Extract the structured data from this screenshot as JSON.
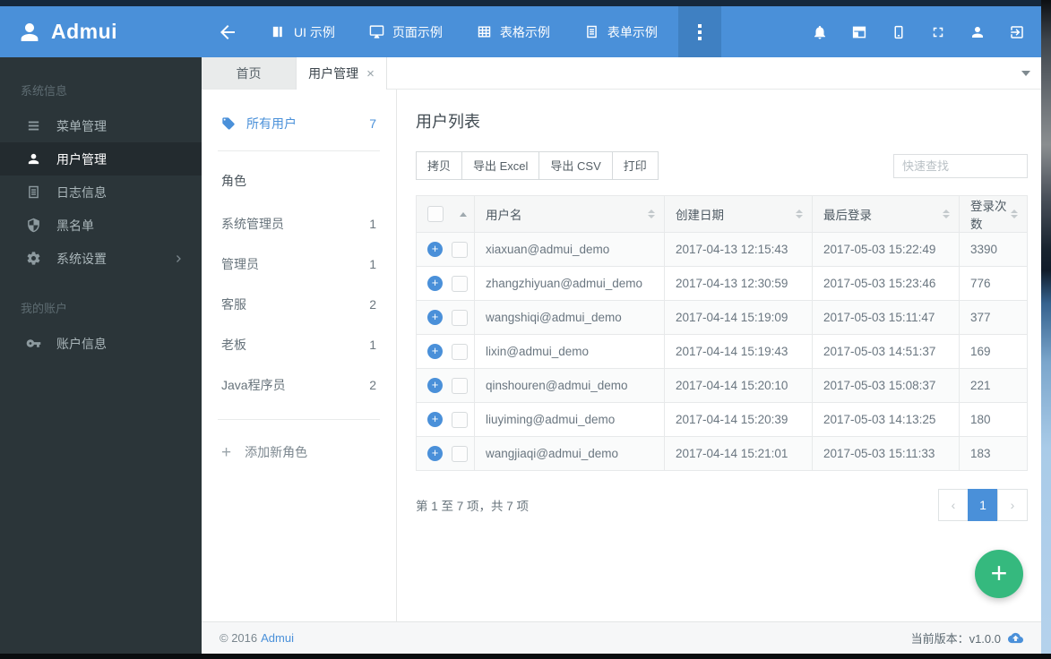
{
  "navbar": {
    "brand": "Admui",
    "items": [
      {
        "label": "UI 示例"
      },
      {
        "label": "页面示例"
      },
      {
        "label": "表格示例"
      },
      {
        "label": "表单示例"
      }
    ]
  },
  "sidebar": {
    "sections": [
      {
        "label": "系统信息",
        "items": [
          {
            "label": "菜单管理"
          },
          {
            "label": "用户管理"
          },
          {
            "label": "日志信息"
          },
          {
            "label": "黑名单"
          },
          {
            "label": "系统设置"
          }
        ]
      },
      {
        "label": "我的账户",
        "items": [
          {
            "label": "账户信息"
          }
        ]
      }
    ]
  },
  "tabs": [
    {
      "label": "首页"
    },
    {
      "label": "用户管理"
    }
  ],
  "user_panel": {
    "all_users_label": "所有用户",
    "all_users_count": "7",
    "roles_label": "角色",
    "roles": [
      {
        "name": "系统管理员",
        "count": "1"
      },
      {
        "name": "管理员",
        "count": "1"
      },
      {
        "name": "客服",
        "count": "2"
      },
      {
        "name": "老板",
        "count": "1"
      },
      {
        "name": "Java程序员",
        "count": "2"
      }
    ],
    "add_role_label": "添加新角色"
  },
  "main": {
    "title": "用户列表",
    "toolbar": {
      "copy": "拷贝",
      "export_excel": "导出 Excel",
      "export_csv": "导出 CSV",
      "print": "打印",
      "search_placeholder": "快速查找"
    },
    "table": {
      "columns": [
        "用户名",
        "创建日期",
        "最后登录",
        "登录次数"
      ],
      "rows": [
        {
          "username": "xiaxuan@admui_demo",
          "created": "2017-04-13 12:15:43",
          "last_login": "2017-05-03 15:22:49",
          "logins": "3390"
        },
        {
          "username": "zhangzhiyuan@admui_demo",
          "created": "2017-04-13 12:30:59",
          "last_login": "2017-05-03 15:23:46",
          "logins": "776"
        },
        {
          "username": "wangshiqi@admui_demo",
          "created": "2017-04-14 15:19:09",
          "last_login": "2017-05-03 15:11:47",
          "logins": "377"
        },
        {
          "username": "lixin@admui_demo",
          "created": "2017-04-14 15:19:43",
          "last_login": "2017-05-03 14:51:37",
          "logins": "169"
        },
        {
          "username": "qinshouren@admui_demo",
          "created": "2017-04-14 15:20:10",
          "last_login": "2017-05-03 15:08:37",
          "logins": "221"
        },
        {
          "username": "liuyiming@admui_demo",
          "created": "2017-04-14 15:20:39",
          "last_login": "2017-05-03 14:13:25",
          "logins": "180"
        },
        {
          "username": "wangjiaqi@admui_demo",
          "created": "2017-04-14 15:21:01",
          "last_login": "2017-05-03 15:11:33",
          "logins": "183"
        }
      ]
    },
    "pagination": {
      "info": "第 1 至 7 项，共 7 项",
      "current_page": "1"
    }
  },
  "footer": {
    "copyright": "© 2016",
    "brand_link": "Admui",
    "version_label": "当前版本：v1.0.0"
  },
  "glyphs": {
    "plus": "+",
    "close": "×",
    "prev": "‹",
    "next": "›"
  },
  "colors": {
    "accent": "#4a90d9",
    "navbar_bg": "#4a90d9",
    "navbar_more_bg": "#3f80c2",
    "top_strip": "#15283c",
    "sidebar_bg": "#2b3539",
    "sidebar_active_bg": "#232b2f",
    "fab_green": "#35b97e",
    "footer_bg": "#f6f7f8"
  }
}
